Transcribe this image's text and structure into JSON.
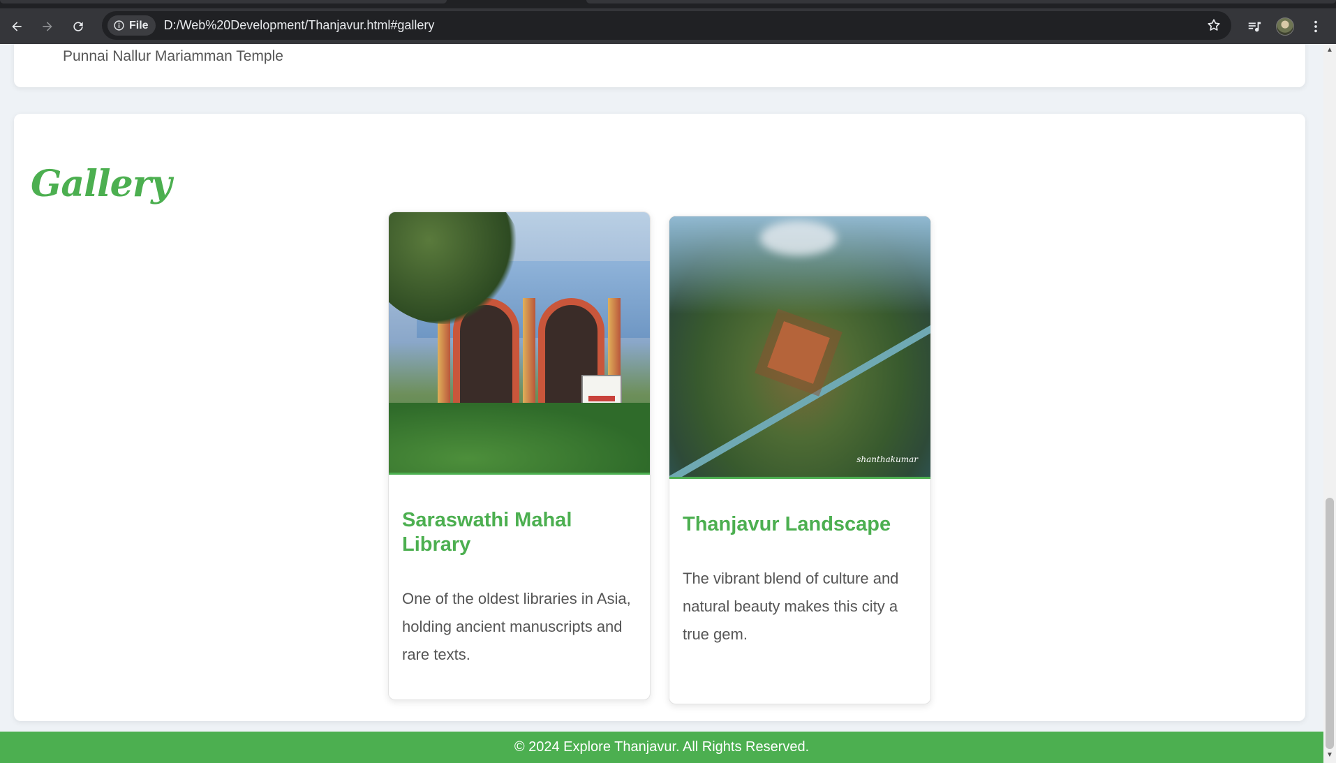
{
  "browser": {
    "site_chip_label": "File",
    "url": "D:/Web%20Development/Thanjavur.html#gallery"
  },
  "page": {
    "previous_section_cut_text": "Punnai Nallur Mariamman Temple",
    "gallery": {
      "title": "Gallery",
      "items": [
        {
          "title": "Saraswathi Mahal Library",
          "description": "One of the oldest libraries in Asia, holding ancient manuscripts and rare texts."
        },
        {
          "title": "Thanjavur Landscape",
          "description": "The vibrant blend of culture and natural beauty makes this city a true gem.",
          "image_signature": "shanthakumar"
        }
      ]
    },
    "footer_text": "© 2024 Explore Thanjavur. All Rights Reserved."
  },
  "colors": {
    "accent": "#4caf50",
    "chrome_toolbar": "#35363a",
    "chrome_omnibox": "#202124",
    "page_background": "#eef2f6"
  }
}
